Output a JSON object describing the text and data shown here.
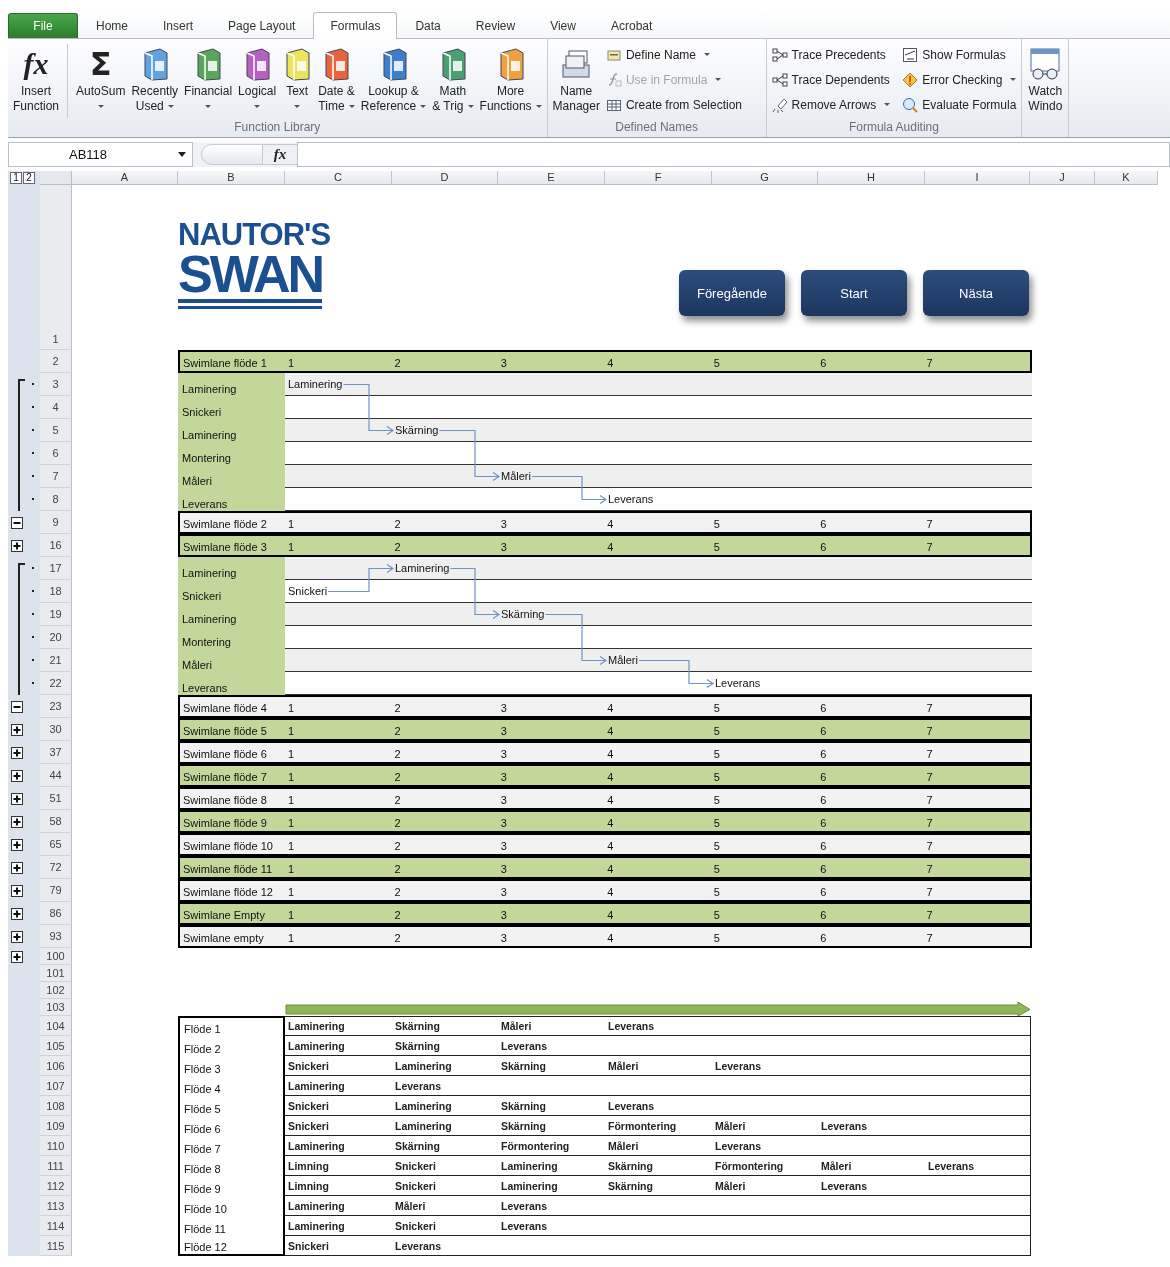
{
  "ribbon": {
    "tabs": [
      {
        "label": "File",
        "kind": "file",
        "selected": false
      },
      {
        "label": "Home",
        "kind": "tab",
        "selected": false
      },
      {
        "label": "Insert",
        "kind": "tab",
        "selected": false
      },
      {
        "label": "Page Layout",
        "kind": "tab",
        "selected": false
      },
      {
        "label": "Formulas",
        "kind": "tab",
        "selected": true
      },
      {
        "label": "Data",
        "kind": "tab",
        "selected": false
      },
      {
        "label": "Review",
        "kind": "tab",
        "selected": false
      },
      {
        "label": "View",
        "kind": "tab",
        "selected": false
      },
      {
        "label": "Acrobat",
        "kind": "tab",
        "selected": false
      }
    ],
    "groups": [
      {
        "title": "Function Library",
        "large": [
          {
            "label": "Insert\nFunction",
            "glyph": "fx",
            "dropdown": false
          },
          {
            "label": "AutoSum",
            "glyph": "Σ",
            "dropdown": true
          },
          {
            "label": "Recently\nUsed",
            "dropdown": true
          },
          {
            "label": "Financial",
            "dropdown": true
          },
          {
            "label": "Logical",
            "dropdown": true
          },
          {
            "label": "Text",
            "dropdown": true
          },
          {
            "label": "Date &\nTime",
            "dropdown": true
          },
          {
            "label": "Lookup &\nReference",
            "dropdown": true
          },
          {
            "label": "Math\n& Trig",
            "dropdown": true
          },
          {
            "label": "More\nFunctions",
            "dropdown": true
          }
        ]
      },
      {
        "title": "Defined Names",
        "large": [
          {
            "label": "Name\nManager",
            "dropdown": false
          }
        ],
        "small": [
          {
            "label": "Define Name",
            "dropdown": true,
            "disabled": false
          },
          {
            "label": "Use in Formula",
            "dropdown": true,
            "disabled": true
          },
          {
            "label": "Create from Selection",
            "dropdown": false,
            "disabled": false
          }
        ]
      },
      {
        "title": "Formula Auditing",
        "small": [
          {
            "label": "Trace Precedents",
            "dropdown": false,
            "disabled": false
          },
          {
            "label": "Trace Dependents",
            "dropdown": false,
            "disabled": false
          },
          {
            "label": "Remove Arrows",
            "dropdown": true,
            "disabled": false
          },
          {
            "label": "Show Formulas",
            "dropdown": false,
            "disabled": false
          },
          {
            "label": "Error Checking",
            "dropdown": true,
            "disabled": false
          },
          {
            "label": "Evaluate Formula",
            "dropdown": false,
            "disabled": false
          }
        ]
      },
      {
        "large": [
          {
            "label": "Watch\nWindo",
            "dropdown": false
          }
        ]
      }
    ]
  },
  "formula_bar": {
    "name_box": "AB118",
    "function_button": "fx"
  },
  "sheet": {
    "outline_levels": [
      "1",
      "2"
    ],
    "column_headers": [
      "A",
      "B",
      "C",
      "D",
      "E",
      "F",
      "G",
      "H",
      "I",
      "J",
      "K"
    ],
    "banner": {
      "row": "1",
      "logo": [
        "NAUTOR'S",
        "SWAN"
      ],
      "buttons": [
        "Föregående",
        "Start",
        "Nästa"
      ]
    },
    "swimlanes": [
      {
        "row": "2",
        "title": "Swimlane flöde 1",
        "shaded": true,
        "numbers": [
          "1",
          "2",
          "3",
          "4",
          "5",
          "6",
          "7"
        ],
        "lanes": [
          {
            "row": "3",
            "label": "Laminering",
            "shaded": true,
            "cells": [
              "Laminering"
            ]
          },
          {
            "row": "4",
            "label": "Snickeri",
            "shaded": false
          },
          {
            "row": "5",
            "label": "Laminering",
            "shaded": true,
            "cells": [
              null,
              "Skärning"
            ]
          },
          {
            "row": "6",
            "label": "Montering",
            "shaded": false
          },
          {
            "row": "7",
            "label": "Måleri",
            "shaded": true,
            "cells": [
              null,
              null,
              "Måleri"
            ]
          },
          {
            "row": "8",
            "label": "Leverans",
            "shaded": false,
            "cells": [
              null,
              null,
              null,
              "Leverans"
            ]
          }
        ]
      },
      {
        "row": "9",
        "title": "Swimlane flöde 2",
        "shaded": false,
        "expanded": true,
        "numbers": [
          "1",
          "2",
          "3",
          "4",
          "5",
          "6",
          "7"
        ]
      },
      {
        "row": "16",
        "title": "Swimlane flöde 3",
        "shaded": true,
        "expanded": false,
        "numbers": [
          "1",
          "2",
          "3",
          "4",
          "5",
          "6",
          "7"
        ],
        "lanes": [
          {
            "row": "17",
            "label": "Laminering",
            "shaded": true,
            "cells": [
              null,
              "Laminering"
            ]
          },
          {
            "row": "18",
            "label": "Snickeri",
            "shaded": false,
            "cells": [
              "Snickeri"
            ]
          },
          {
            "row": "19",
            "label": "Laminering",
            "shaded": true,
            "cells": [
              null,
              null,
              "Skärning"
            ]
          },
          {
            "row": "20",
            "label": "Montering",
            "shaded": false
          },
          {
            "row": "21",
            "label": "Måleri",
            "shaded": true,
            "cells": [
              null,
              null,
              null,
              "Måleri"
            ]
          },
          {
            "row": "22",
            "label": "Leverans",
            "shaded": false,
            "cells": [
              null,
              null,
              null,
              null,
              "Leverans"
            ]
          }
        ]
      },
      {
        "row": "23",
        "title": "Swimlane flöde 4",
        "shaded": false,
        "expanded": true,
        "numbers": [
          "1",
          "2",
          "3",
          "4",
          "5",
          "6",
          "7"
        ]
      },
      {
        "row": "30",
        "title": "Swimlane flöde 5",
        "shaded": true,
        "expanded": false,
        "numbers": [
          "1",
          "2",
          "3",
          "4",
          "5",
          "6",
          "7"
        ]
      },
      {
        "row": "37",
        "title": "Swimlane flöde 6",
        "shaded": false,
        "expanded": false,
        "numbers": [
          "1",
          "2",
          "3",
          "4",
          "5",
          "6",
          "7"
        ]
      },
      {
        "row": "44",
        "title": "Swimlane flöde 7",
        "shaded": true,
        "expanded": false,
        "numbers": [
          "1",
          "2",
          "3",
          "4",
          "5",
          "6",
          "7"
        ]
      },
      {
        "row": "51",
        "title": "Swimlane flöde 8",
        "shaded": false,
        "expanded": false,
        "numbers": [
          "1",
          "2",
          "3",
          "4",
          "5",
          "6",
          "7"
        ]
      },
      {
        "row": "58",
        "title": "Swimlane flöde 9",
        "shaded": true,
        "expanded": false,
        "numbers": [
          "1",
          "2",
          "3",
          "4",
          "5",
          "6",
          "7"
        ]
      },
      {
        "row": "65",
        "title": "Swimlane flöde 10",
        "shaded": false,
        "expanded": false,
        "numbers": [
          "1",
          "2",
          "3",
          "4",
          "5",
          "6",
          "7"
        ]
      },
      {
        "row": "72",
        "title": "Swimlane flöde 11",
        "shaded": true,
        "expanded": false,
        "numbers": [
          "1",
          "2",
          "3",
          "4",
          "5",
          "6",
          "7"
        ]
      },
      {
        "row": "79",
        "title": "Swimlane flöde 12",
        "shaded": false,
        "expanded": false,
        "numbers": [
          "1",
          "2",
          "3",
          "4",
          "5",
          "6",
          "7"
        ]
      },
      {
        "row": "86",
        "title": "Swimlane Empty",
        "shaded": true,
        "expanded": false,
        "numbers": [
          "1",
          "2",
          "3",
          "4",
          "5",
          "6",
          "7"
        ]
      },
      {
        "row": "93",
        "title": "Swimlane empty",
        "shaded": false,
        "expanded": false,
        "numbers": [
          "1",
          "2",
          "3",
          "4",
          "5",
          "6",
          "7"
        ]
      }
    ],
    "spacer_rows": [
      {
        "row": "100",
        "expanded": false
      },
      {
        "row": "101"
      },
      {
        "row": "102"
      },
      {
        "row": "103"
      }
    ],
    "flows": [
      {
        "row": "104",
        "name": "Flöde 1",
        "steps": [
          "Laminering",
          "Skärning",
          "Måleri",
          "Leverans"
        ]
      },
      {
        "row": "105",
        "name": "Flöde 2",
        "steps": [
          "Laminering",
          "Skärning",
          "Leverans"
        ]
      },
      {
        "row": "106",
        "name": "Flöde 3",
        "steps": [
          "Snickeri",
          "Laminering",
          "Skärning",
          "Måleri",
          "Leverans"
        ]
      },
      {
        "row": "107",
        "name": "Flöde 4",
        "steps": [
          "Laminering",
          "Leverans"
        ]
      },
      {
        "row": "108",
        "name": "Flöde 5",
        "steps": [
          "Snickeri",
          "Laminering",
          "Skärning",
          "Leverans"
        ]
      },
      {
        "row": "109",
        "name": "Flöde 6",
        "steps": [
          "Snickeri",
          "Laminering",
          "Skärning",
          "Förmontering",
          "Måleri",
          "Leverans"
        ]
      },
      {
        "row": "110",
        "name": "Flöde 7",
        "steps": [
          "Laminering",
          "Skärning",
          "Förmontering",
          "Måleri",
          "Leverans"
        ]
      },
      {
        "row": "111",
        "name": "Flöde 8",
        "steps": [
          "Limning",
          "Snickeri",
          "Laminering",
          "Skärning",
          "Förmontering",
          "Måleri",
          "Leverans"
        ]
      },
      {
        "row": "112",
        "name": "Flöde 9",
        "steps": [
          "Limning",
          "Snickeri",
          "Laminering",
          "Skärning",
          "Måleri",
          "Leverans"
        ]
      },
      {
        "row": "113",
        "name": "Flöde 10",
        "steps": [
          "Laminering",
          "Måleri",
          "Leverans"
        ]
      },
      {
        "row": "114",
        "name": "Flöde 11",
        "steps": [
          "Laminering",
          "Snickeri",
          "Leverans"
        ]
      },
      {
        "row": "115",
        "name": "Flöde 12",
        "steps": [
          "Snickeri",
          "Leverans"
        ]
      }
    ]
  }
}
